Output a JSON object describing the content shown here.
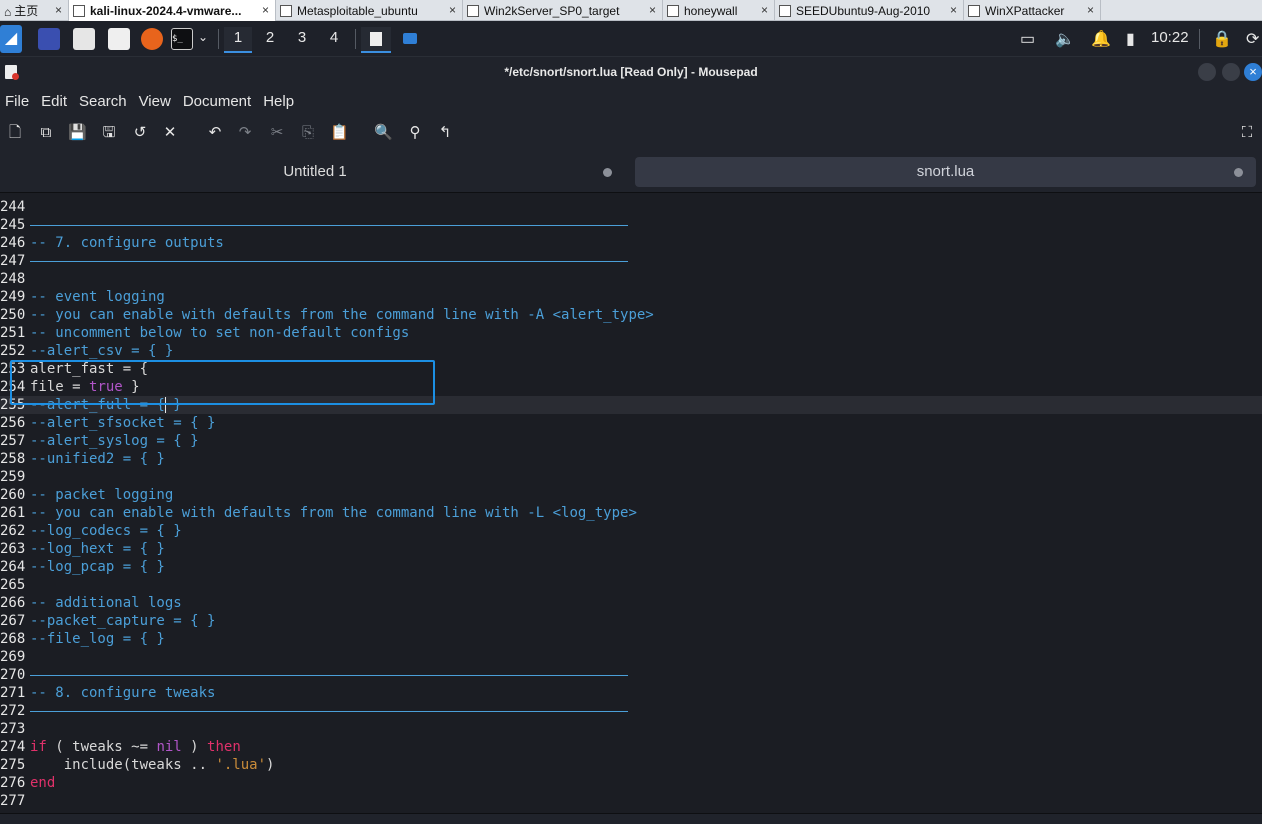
{
  "vm_tabs": [
    {
      "label": "主页",
      "icon": "home-icon"
    },
    {
      "label": "kali-linux-2024.4-vmware...",
      "icon": "vm-icon"
    },
    {
      "label": "Metasploitable_ubuntu",
      "icon": "vm-icon"
    },
    {
      "label": "Win2kServer_SP0_target",
      "icon": "vm-icon"
    },
    {
      "label": "honeywall",
      "icon": "vm-icon"
    },
    {
      "label": "SEEDUbuntu9-Aug-2010",
      "icon": "vm-icon"
    },
    {
      "label": "WinXPattacker",
      "icon": "vm-icon"
    }
  ],
  "vm_close_glyph": "×",
  "panel": {
    "workspaces": [
      "1",
      "2",
      "3",
      "4"
    ],
    "active_workspace": "1",
    "clock": "10:22",
    "terminal_glyph": "$_"
  },
  "window": {
    "title": "*/etc/snort/snort.lua [Read Only] - Mousepad",
    "close_glyph": "×"
  },
  "menu": [
    "File",
    "Edit",
    "Search",
    "View",
    "Document",
    "Help"
  ],
  "tabs": [
    {
      "label": "Untitled 1"
    },
    {
      "label": "snort.lua",
      "active": true
    }
  ],
  "editor": {
    "lines": [
      {
        "n": "244",
        "t": ""
      },
      {
        "n": "245",
        "t": "",
        "rule": true
      },
      {
        "n": "246",
        "t": "-- 7. configure outputs",
        "cls": "cm"
      },
      {
        "n": "247",
        "t": "",
        "rule": true
      },
      {
        "n": "248",
        "t": ""
      },
      {
        "n": "249",
        "t": "-- event logging",
        "cls": "cm"
      },
      {
        "n": "250",
        "t": "-- you can enable with defaults from the command line with -A <alert_type>",
        "cls": "cm"
      },
      {
        "n": "251",
        "t": "-- uncomment below to set non-default configs",
        "cls": "cm"
      },
      {
        "n": "252",
        "t": "--alert_csv = { }",
        "cls": "cm"
      },
      {
        "n": "253",
        "t": "alert_fast = {"
      },
      {
        "n": "254",
        "t": "file = ",
        "tail_bool": "true",
        "tail": " }"
      },
      {
        "n": "255",
        "t": "--alert_full = { }",
        "cls": "cm",
        "current": true
      },
      {
        "n": "256",
        "t": "--alert_sfsocket = { }",
        "cls": "cm"
      },
      {
        "n": "257",
        "t": "--alert_syslog = { }",
        "cls": "cm"
      },
      {
        "n": "258",
        "t": "--unified2 = { }",
        "cls": "cm"
      },
      {
        "n": "259",
        "t": ""
      },
      {
        "n": "260",
        "t": "-- packet logging",
        "cls": "cm"
      },
      {
        "n": "261",
        "t": "-- you can enable with defaults from the command line with -L <log_type>",
        "cls": "cm"
      },
      {
        "n": "262",
        "t": "--log_codecs = { }",
        "cls": "cm"
      },
      {
        "n": "263",
        "t": "--log_hext = { }",
        "cls": "cm"
      },
      {
        "n": "264",
        "t": "--log_pcap = { }",
        "cls": "cm"
      },
      {
        "n": "265",
        "t": ""
      },
      {
        "n": "266",
        "t": "-- additional logs",
        "cls": "cm"
      },
      {
        "n": "267",
        "t": "--packet_capture = { }",
        "cls": "cm"
      },
      {
        "n": "268",
        "t": "--file_log = { }",
        "cls": "cm"
      },
      {
        "n": "269",
        "t": ""
      },
      {
        "n": "270",
        "t": "",
        "rule": true
      },
      {
        "n": "271",
        "t": "-- 8. configure tweaks",
        "cls": "cm"
      },
      {
        "n": "272",
        "t": "",
        "rule": true
      },
      {
        "n": "273",
        "t": ""
      },
      {
        "n": "274",
        "kw1": "if",
        "mid": " ( tweaks ~= ",
        "bool": "nil",
        "mid2": " ) ",
        "kw2": "then"
      },
      {
        "n": "275",
        "t": "    include(tweaks .. ",
        "str": "'.lua'",
        "tail": ")"
      },
      {
        "n": "276",
        "kw1": "end"
      },
      {
        "n": "277",
        "t": ""
      }
    ]
  },
  "colors": {
    "comment": "#4b9fd8",
    "keyword": "#e0316a",
    "boolean": "#b055c7",
    "string": "#c98c3a",
    "annotation_box": "#1c8fe3",
    "accent": "#2f7fd6"
  }
}
